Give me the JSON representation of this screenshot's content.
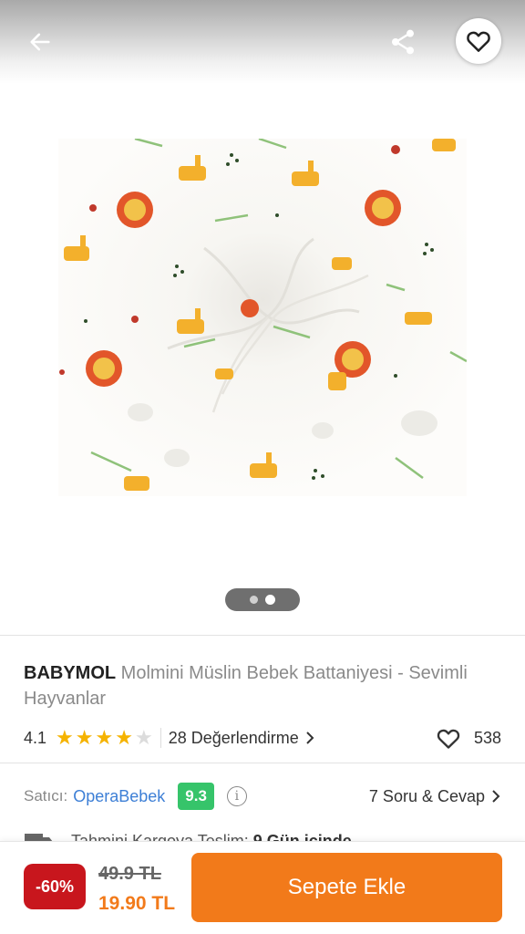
{
  "product": {
    "brand": "BABYMOL",
    "name": "Molmini Müslin Bebek Battaniyesi - Sevimli Hayvanlar",
    "rating": "4.1",
    "rating_value": 4.1,
    "rating_max": 5,
    "reviews_label": "28 Değerlendirme",
    "likes_count": "538"
  },
  "gallery": {
    "image_count": 2,
    "active_index": 1
  },
  "seller": {
    "label": "Satıcı:",
    "name": "OperaBebek",
    "score": "9.3",
    "qa_label": "7 Soru & Cevap"
  },
  "shipping": {
    "label": "Tahmini Kargoya Teslim:",
    "value": "9 Gün içinde"
  },
  "purchase": {
    "discount": "-60%",
    "old_price": "49.9 TL",
    "new_price": "19.90 TL",
    "add_to_cart_label": "Sepete Ekle"
  },
  "icons": {
    "back": "arrow-left-icon",
    "share": "share-icon",
    "favorite": "heart-outline-icon",
    "info": "info-icon",
    "truck": "truck-icon",
    "chevron": "chevron-right-icon"
  },
  "colors": {
    "accent": "#f27a1a",
    "discount": "#c8161d",
    "seller_link": "#3d7fd6",
    "seller_score": "#36c46a",
    "star": "#f5b300"
  }
}
